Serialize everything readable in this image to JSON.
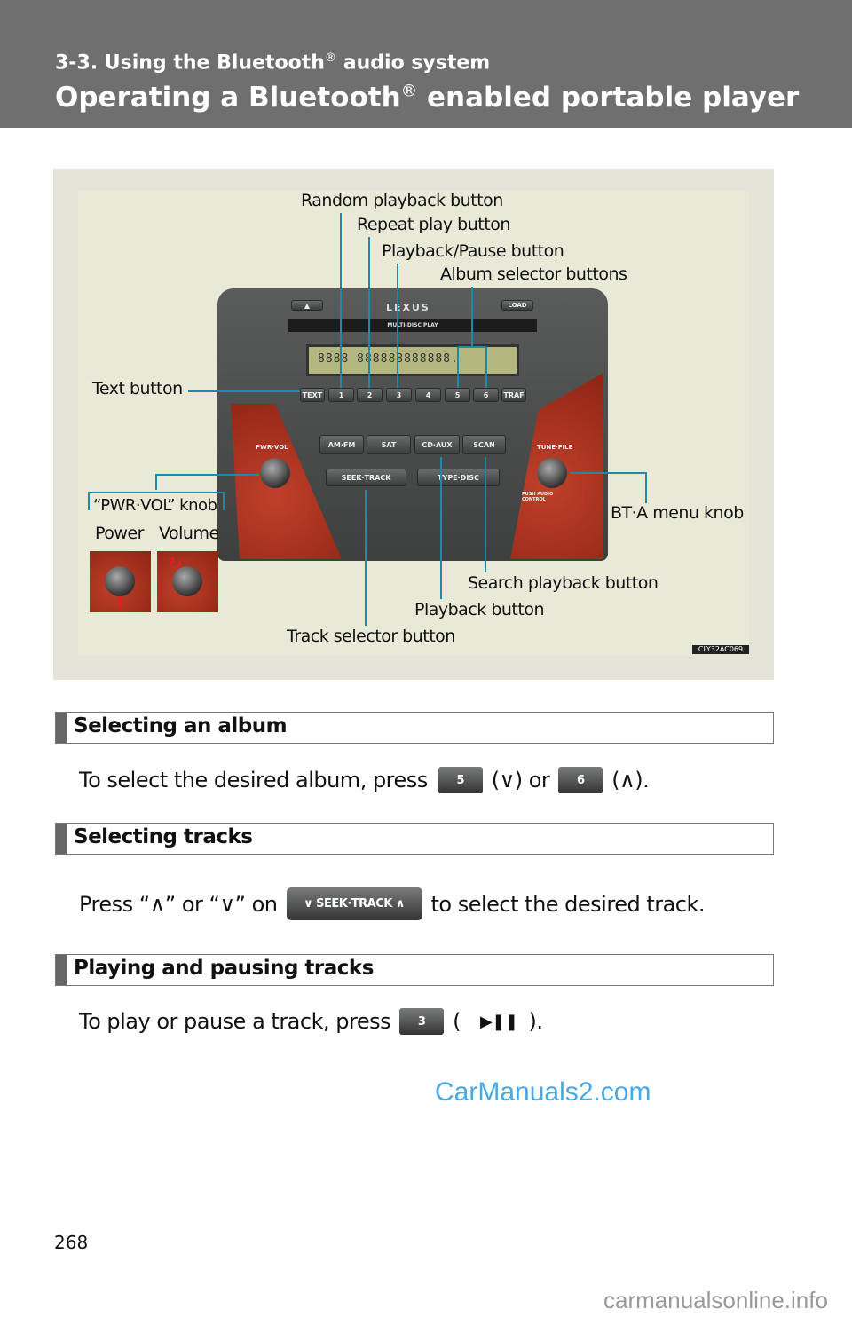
{
  "header": {
    "section": "3-3. Using the Bluetooth",
    "section_reg": "®",
    "section_rest": " audio system",
    "title": "Operating a Bluetooth",
    "title_reg": "®",
    "title_rest": " enabled portable player"
  },
  "figure": {
    "labels": {
      "random": "Random playback button",
      "repeat": "Repeat play button",
      "playpause": "Playback/Pause button",
      "album": "Album selector buttons",
      "text": "Text button",
      "pwr_knob": "“PWR·VOL” knob",
      "power": "Power",
      "volume": "Volume",
      "bta": "BT·A menu knob",
      "search": "Search playback button",
      "playback": "Playback button",
      "track": "Track selector button"
    },
    "unit": {
      "eject": "▲",
      "brand": "LEXUS",
      "load": "LOAD",
      "slot": "MULTI-DISC PLAY",
      "lcd": "8888  888888888888.",
      "presets": [
        "TEXT",
        "1",
        "2",
        "3",
        "4",
        "5",
        "6",
        "TRAF"
      ],
      "sources": [
        "AM·FM",
        "SAT",
        "CD·AUX",
        "SCAN"
      ],
      "seek": "SEEK·TRACK",
      "type": "TYPE·DISC",
      "pwr": "PWR·VOL",
      "tune": "TUNE·FILE",
      "push": "PUSH AUDIO CONTROL"
    },
    "code": "CLY32AC069",
    "line_color": "#1e8aa8"
  },
  "sections": [
    {
      "title": "Selecting an album",
      "pre": "To select the desired album, press",
      "btn1": "5",
      "mid": "(∨) or",
      "btn2": "6",
      "post": "(∧)."
    },
    {
      "title": "Selecting tracks",
      "pre": "Press “∧” or “∨” on",
      "btn": "∨ SEEK·TRACK ∧",
      "post": "to select the desired track."
    },
    {
      "title": "Playing and pausing tracks",
      "pre": "To play or pause a track, press",
      "btn": "3",
      "open": "(",
      "icon": "▶❚❚",
      "close": ")."
    }
  ],
  "page_number": "268",
  "watermarks": [
    "CarManuals2.com",
    "carmanualsonline.info"
  ]
}
